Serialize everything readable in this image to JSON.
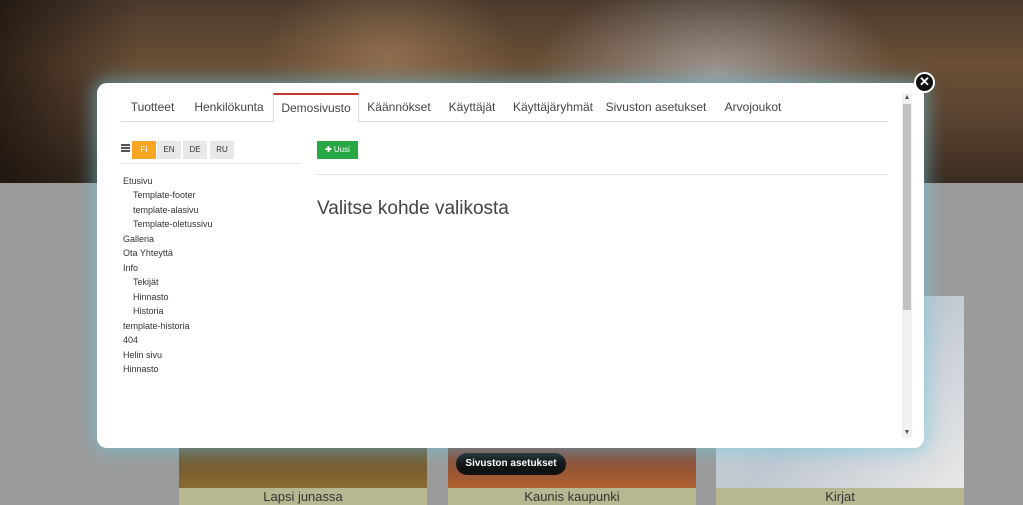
{
  "modal": {
    "tabs": [
      {
        "label": "Tuotteet"
      },
      {
        "label": "Henkilökunta"
      },
      {
        "label": "Demosivusto"
      },
      {
        "label": "Käännökset"
      },
      {
        "label": "Käyttäjät"
      },
      {
        "label": "Käyttäjäryhmät"
      },
      {
        "label": "Sivuston asetukset"
      },
      {
        "label": "Arvojoukot"
      }
    ],
    "active_tab": "Demosivusto",
    "languages": [
      "FI",
      "EN",
      "DE",
      "RU"
    ],
    "active_language": "FI",
    "new_button_label": "Uusi",
    "content_title": "Valitse kohde valikosta",
    "tree": [
      {
        "label": "Etusivu",
        "level": 0
      },
      {
        "label": "Template-footer",
        "level": 1
      },
      {
        "label": "template-alasivu",
        "level": 1
      },
      {
        "label": "Template-oletussivu",
        "level": 1
      },
      {
        "label": "Galleria",
        "level": 0
      },
      {
        "label": "Ota Yhteyttä",
        "level": 0
      },
      {
        "label": "Info",
        "level": 0
      },
      {
        "label": "Tekijät",
        "level": 1
      },
      {
        "label": "Hinnasto",
        "level": 1
      },
      {
        "label": "Historia",
        "level": 1
      },
      {
        "label": "template-historia",
        "level": 0
      },
      {
        "label": "404",
        "level": 0
      },
      {
        "label": "Helin sivu",
        "level": 0
      },
      {
        "label": "Hinnasto",
        "level": 0
      }
    ],
    "close_icon": "close-icon",
    "accent_color": "#c0392b",
    "active_lang_color": "#f6a623",
    "new_button_color": "#28a745"
  },
  "background": {
    "settings_button_label": "Sivuston asetukset",
    "cards": [
      {
        "caption": "Lapsi junassa"
      },
      {
        "caption": "Kaunis kaupunki"
      },
      {
        "caption": "Kirjat"
      }
    ]
  }
}
